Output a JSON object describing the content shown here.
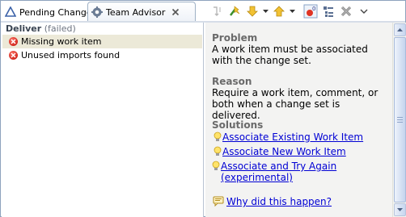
{
  "tabs": {
    "pending_label": "Pending Changes",
    "advisor_label": "Team Advisor"
  },
  "toolbar": {
    "icons": [
      "team-sync-icon",
      "run-icon",
      "dropdown-arrow-icon",
      "down-arrow-icon",
      "dropdown-arrow-icon",
      "up-arrow-icon",
      "dropdown-arrow-icon",
      "error-filter-icon",
      "collapse-icon",
      "remove-all-icon",
      "view-menu-icon"
    ]
  },
  "left": {
    "group_name": "Deliver",
    "group_status": "(failed)",
    "items": [
      {
        "label": "Missing work item",
        "selected": true
      },
      {
        "label": "Unused imports found",
        "selected": false
      }
    ]
  },
  "detail": {
    "problem_title": "Problem",
    "problem_text": "A work item must be associated with the change set.",
    "reason_title": "Reason",
    "reason_text": "Require a work item, comment, or both when a change set is delivered.",
    "solutions_title": "Solutions",
    "solutions": [
      "Associate Existing Work Item",
      "Associate New Work Item",
      "Associate and Try Again (experimental)"
    ],
    "help_link": "Why did this happen?"
  },
  "colors": {
    "link": "#0000d4",
    "selected_row": "#ece9d8",
    "detail_bg": "#f3f3f2",
    "error": "#d1261c"
  }
}
